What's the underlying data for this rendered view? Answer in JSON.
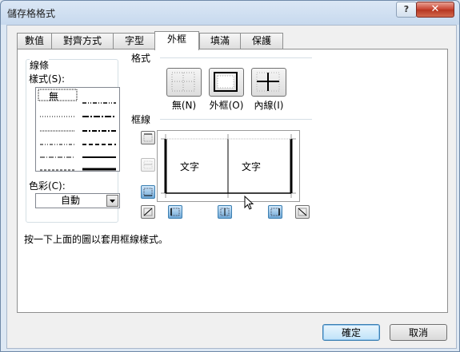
{
  "window": {
    "title": "儲存格格式",
    "help": "?",
    "close": "✕"
  },
  "tabs": [
    {
      "label": "數值"
    },
    {
      "label": "對齊方式"
    },
    {
      "label": "字型"
    },
    {
      "label": "外框"
    },
    {
      "label": "填滿"
    },
    {
      "label": "保護"
    }
  ],
  "active_tab": "外框",
  "line_section": {
    "title": "線條",
    "style_label": "樣式(S):",
    "none_label": "無",
    "color_label": "色彩(C):",
    "color_value": "自動"
  },
  "presets": {
    "title": "格式",
    "none": "無(N)",
    "outline": "外框(O)",
    "inside": "內線(I)"
  },
  "border": {
    "title": "框線",
    "preview_text_left": "文字",
    "preview_text_right": "文字"
  },
  "hint": "按一下上面的圖以套用框線樣式。",
  "buttons": {
    "ok": "確定",
    "cancel": "取消"
  },
  "colors": {
    "accent": "#3c7fb1",
    "titlebar": "#c7d9ee",
    "close": "#c7402d"
  }
}
